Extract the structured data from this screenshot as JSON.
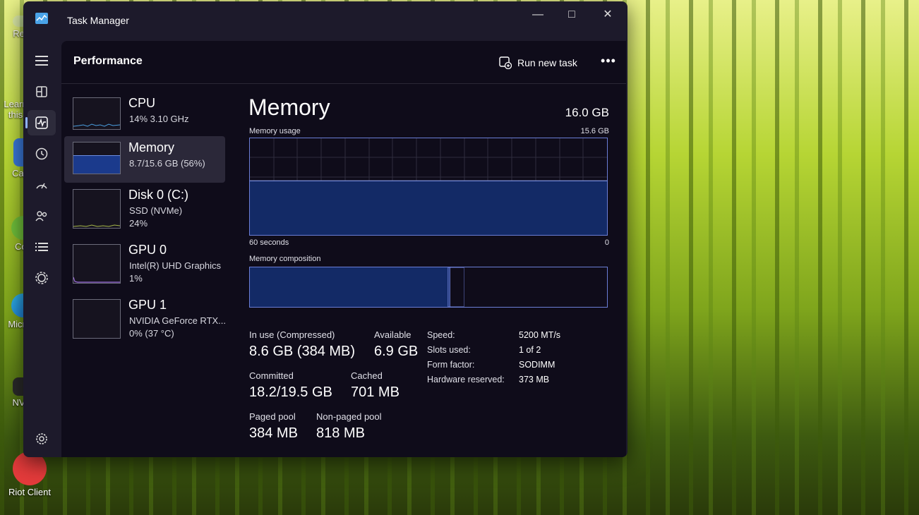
{
  "desktop": {
    "icons": [
      {
        "label": "Recy",
        "icon": "recycle-bin-icon"
      },
      {
        "label": "Learn this",
        "icon": "learn-icon"
      },
      {
        "label": "CapF",
        "icon": "capcut-icon"
      },
      {
        "label": "Cod",
        "icon": "code-icon"
      },
      {
        "label": "Micr Ec",
        "icon": "edge-icon"
      },
      {
        "label": "NVID",
        "icon": "nvidia-icon"
      },
      {
        "label": "Riot Client",
        "icon": "riot-client-icon"
      }
    ]
  },
  "window": {
    "title": "Task Manager",
    "controls": [
      "minimize-icon",
      "maximize-icon",
      "close-icon"
    ]
  },
  "nav": {
    "items": [
      {
        "name": "hamburger-icon",
        "active": false
      },
      {
        "name": "processes-icon",
        "active": false
      },
      {
        "name": "performance-icon",
        "active": true
      },
      {
        "name": "app-history-icon",
        "active": false
      },
      {
        "name": "startup-apps-icon",
        "active": false
      },
      {
        "name": "users-icon",
        "active": false
      },
      {
        "name": "details-icon",
        "active": false
      },
      {
        "name": "services-icon",
        "active": false
      }
    ],
    "settings": "settings-icon"
  },
  "header": {
    "title": "Performance",
    "run_new_task": "Run new task",
    "more": "•••"
  },
  "sidebar": [
    {
      "name": "CPU",
      "sub1": "14%  3.10 GHz",
      "sub2": "",
      "color": "#4a9fe0"
    },
    {
      "name": "Memory",
      "sub1": "8.7/15.6 GB (56%)",
      "sub2": "",
      "color": "#3b5fd1"
    },
    {
      "name": "Disk 0 (C:)",
      "sub1": "SSD (NVMe)",
      "sub2": "24%",
      "color": "#a7b84a"
    },
    {
      "name": "GPU 0",
      "sub1": "Intel(R) UHD Graphics",
      "sub2": "1%",
      "color": "#9a6bd9"
    },
    {
      "name": "GPU 1",
      "sub1": "NVIDIA GeForce RTX...",
      "sub2": "0% (37 °C)",
      "color": "#9a6bd9"
    }
  ],
  "memory": {
    "title": "Memory",
    "total": "16.0 GB",
    "usage_label": "Memory usage",
    "usage_max": "15.6 GB",
    "time_left": "60 seconds",
    "time_right": "0",
    "usage_fraction": 0.56,
    "composition_label": "Memory composition",
    "composition": {
      "in_use": 0.555,
      "modified": 0.005,
      "standby": 0.04,
      "free": 0.4
    },
    "stats": {
      "in_use_label": "In use (Compressed)",
      "in_use_value": "8.6 GB (384 MB)",
      "available_label": "Available",
      "available_value": "6.9 GB",
      "committed_label": "Committed",
      "committed_value": "18.2/19.5 GB",
      "cached_label": "Cached",
      "cached_value": "701 MB",
      "paged_label": "Paged pool",
      "paged_value": "384 MB",
      "nonpaged_label": "Non-paged pool",
      "nonpaged_value": "818 MB"
    },
    "specs": [
      {
        "label": "Speed:",
        "value": "5200 MT/s"
      },
      {
        "label": "Slots used:",
        "value": "1 of 2"
      },
      {
        "label": "Form factor:",
        "value": "SODIMM"
      },
      {
        "label": "Hardware reserved:",
        "value": "373 MB"
      }
    ]
  },
  "colors": {
    "accent": "#8fb2ff",
    "mem_fill": "#132a66",
    "mem_line": "#6b7ed6"
  }
}
